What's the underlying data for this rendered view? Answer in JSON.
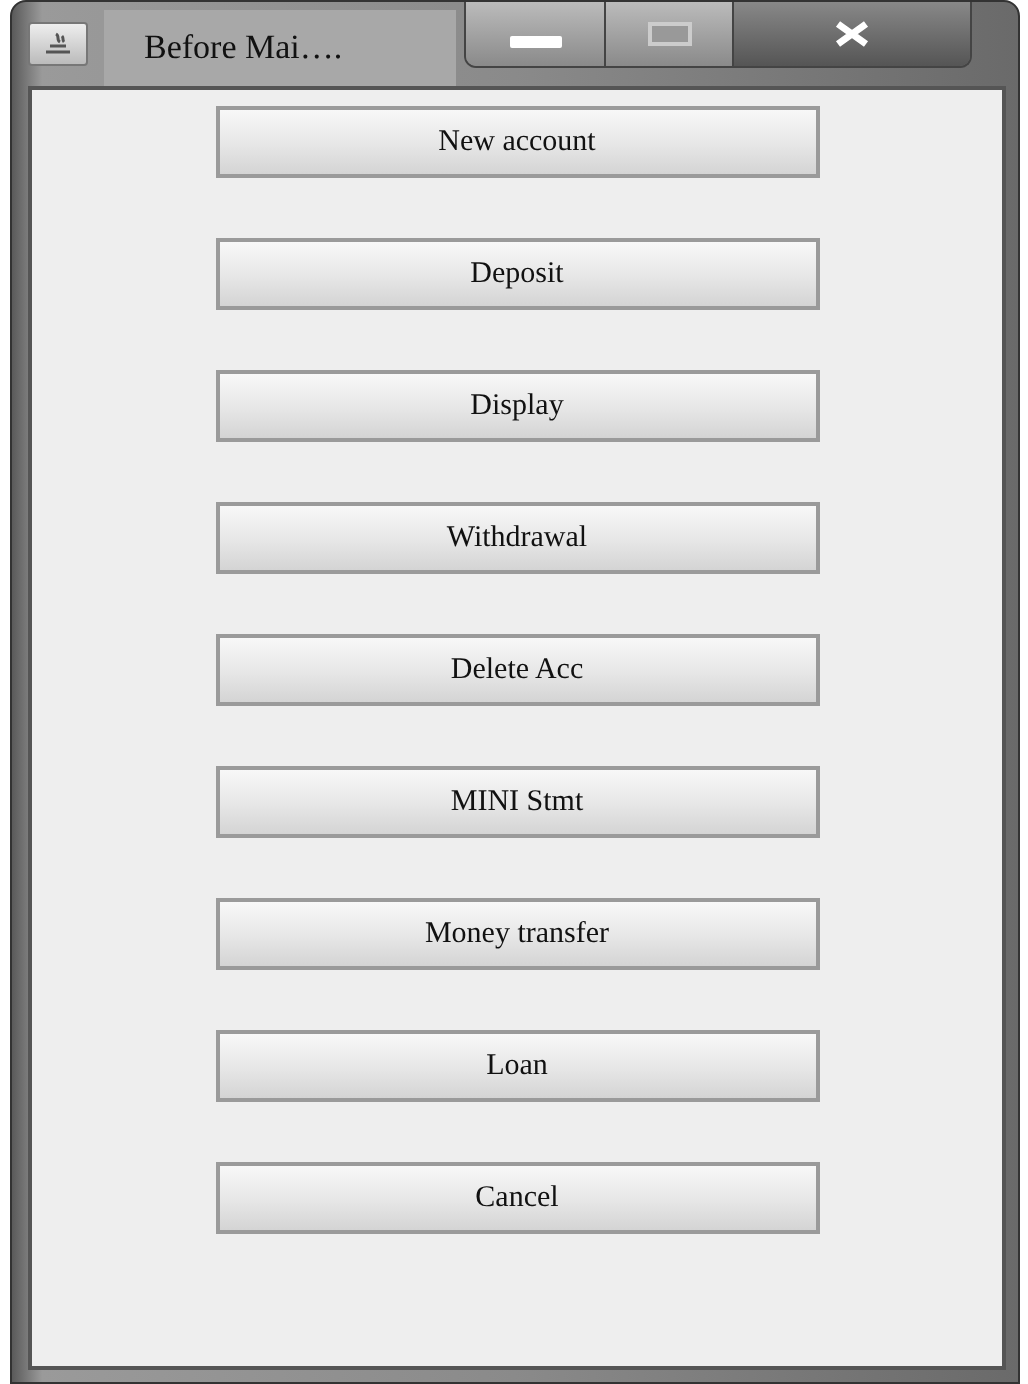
{
  "window": {
    "title": "Before Mai…."
  },
  "buttons": [
    {
      "label": "New account"
    },
    {
      "label": "Deposit"
    },
    {
      "label": "Display"
    },
    {
      "label": "Withdrawal"
    },
    {
      "label": "Delete Acc"
    },
    {
      "label": "MINI Stmt"
    },
    {
      "label": "Money transfer"
    },
    {
      "label": "Loan"
    },
    {
      "label": "Cancel"
    }
  ]
}
